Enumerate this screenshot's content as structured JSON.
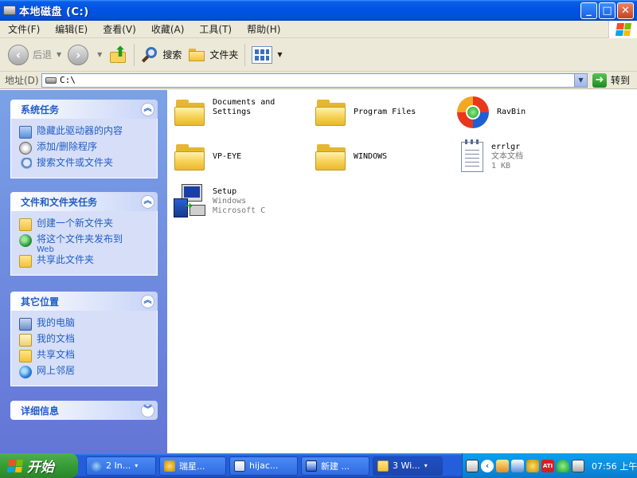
{
  "window": {
    "title": "本地磁盘 (C:)",
    "buttons": {
      "minimize": "_",
      "maximize": "□",
      "close": "✕"
    }
  },
  "menu": [
    "文件(F)",
    "编辑(E)",
    "查看(V)",
    "收藏(A)",
    "工具(T)",
    "帮助(H)"
  ],
  "toolbar": {
    "back_label": "后退",
    "forward_label": "",
    "search_label": "搜索",
    "folders_label": "文件夹"
  },
  "address": {
    "label": "地址(D)",
    "value": "C:\\",
    "go_label": "转到"
  },
  "taskpane": {
    "panels": [
      {
        "title": "系统任务",
        "items": [
          {
            "label": "隐藏此驱动器的内容"
          },
          {
            "label": "添加/删除程序"
          },
          {
            "label": "搜索文件或文件夹"
          }
        ]
      },
      {
        "title": "文件和文件夹任务",
        "items": [
          {
            "label": "创建一个新文件夹"
          },
          {
            "label": "将这个文件夹发布到",
            "sub": "Web"
          },
          {
            "label": "共享此文件夹"
          }
        ]
      },
      {
        "title": "其它位置",
        "items": [
          {
            "label": "我的电脑"
          },
          {
            "label": "我的文档"
          },
          {
            "label": "共享文档"
          },
          {
            "label": "网上邻居"
          }
        ]
      },
      {
        "title": "详细信息",
        "items": []
      }
    ]
  },
  "files": [
    {
      "name": "Documents and\nSettings",
      "type": "folder"
    },
    {
      "name": "Program Files",
      "type": "folder"
    },
    {
      "name": "RavBin",
      "type": "folder-app"
    },
    {
      "name": "VP-EYE",
      "type": "folder"
    },
    {
      "name": "WINDOWS",
      "type": "folder"
    },
    {
      "name": "errlgr",
      "line2": "文本文档",
      "line3": "1 KB",
      "type": "text"
    },
    {
      "name": "Setup",
      "line2": "Windows",
      "line3": "Microsoft C",
      "type": "setup"
    }
  ],
  "taskbar": {
    "start_label": "开始",
    "buttons": [
      {
        "label": "2 In...",
        "drop": "▾"
      },
      {
        "label": "瑞星..."
      },
      {
        "label": "hijac..."
      },
      {
        "label": "新建 ..."
      },
      {
        "label": "3 Wi...",
        "drop": "▾"
      }
    ],
    "clock": "07:56 上午"
  },
  "colors": {
    "titlebar": "#0054e3",
    "taskpane_link": "#215dc6",
    "start_green": "#379c37",
    "tray": "#0e8fe0"
  }
}
